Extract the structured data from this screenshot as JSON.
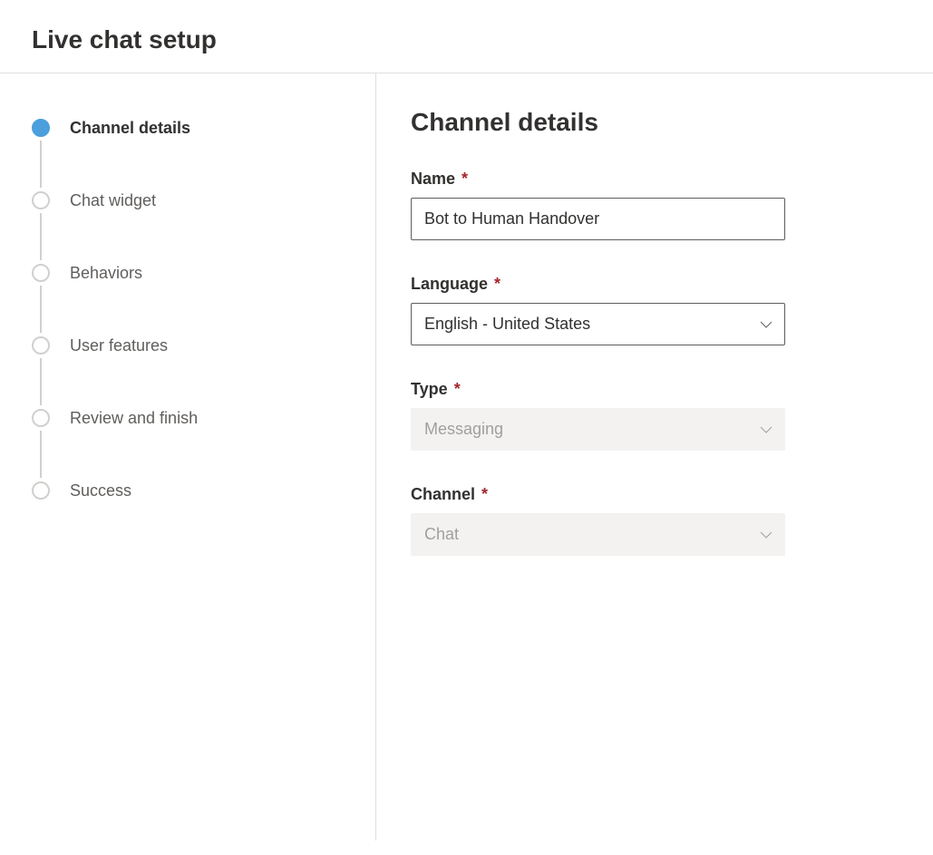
{
  "header": {
    "title": "Live chat setup"
  },
  "stepper": {
    "items": [
      {
        "label": "Channel details",
        "active": true
      },
      {
        "label": "Chat widget",
        "active": false
      },
      {
        "label": "Behaviors",
        "active": false
      },
      {
        "label": "User features",
        "active": false
      },
      {
        "label": "Review and finish",
        "active": false
      },
      {
        "label": "Success",
        "active": false
      }
    ]
  },
  "content": {
    "heading": "Channel details",
    "fields": {
      "name": {
        "label": "Name",
        "value": "Bot to Human Handover",
        "required": true
      },
      "language": {
        "label": "Language",
        "value": "English - United States",
        "required": true
      },
      "type": {
        "label": "Type",
        "value": "Messaging",
        "required": true,
        "disabled": true
      },
      "channel": {
        "label": "Channel",
        "value": "Chat",
        "required": true,
        "disabled": true
      }
    }
  }
}
